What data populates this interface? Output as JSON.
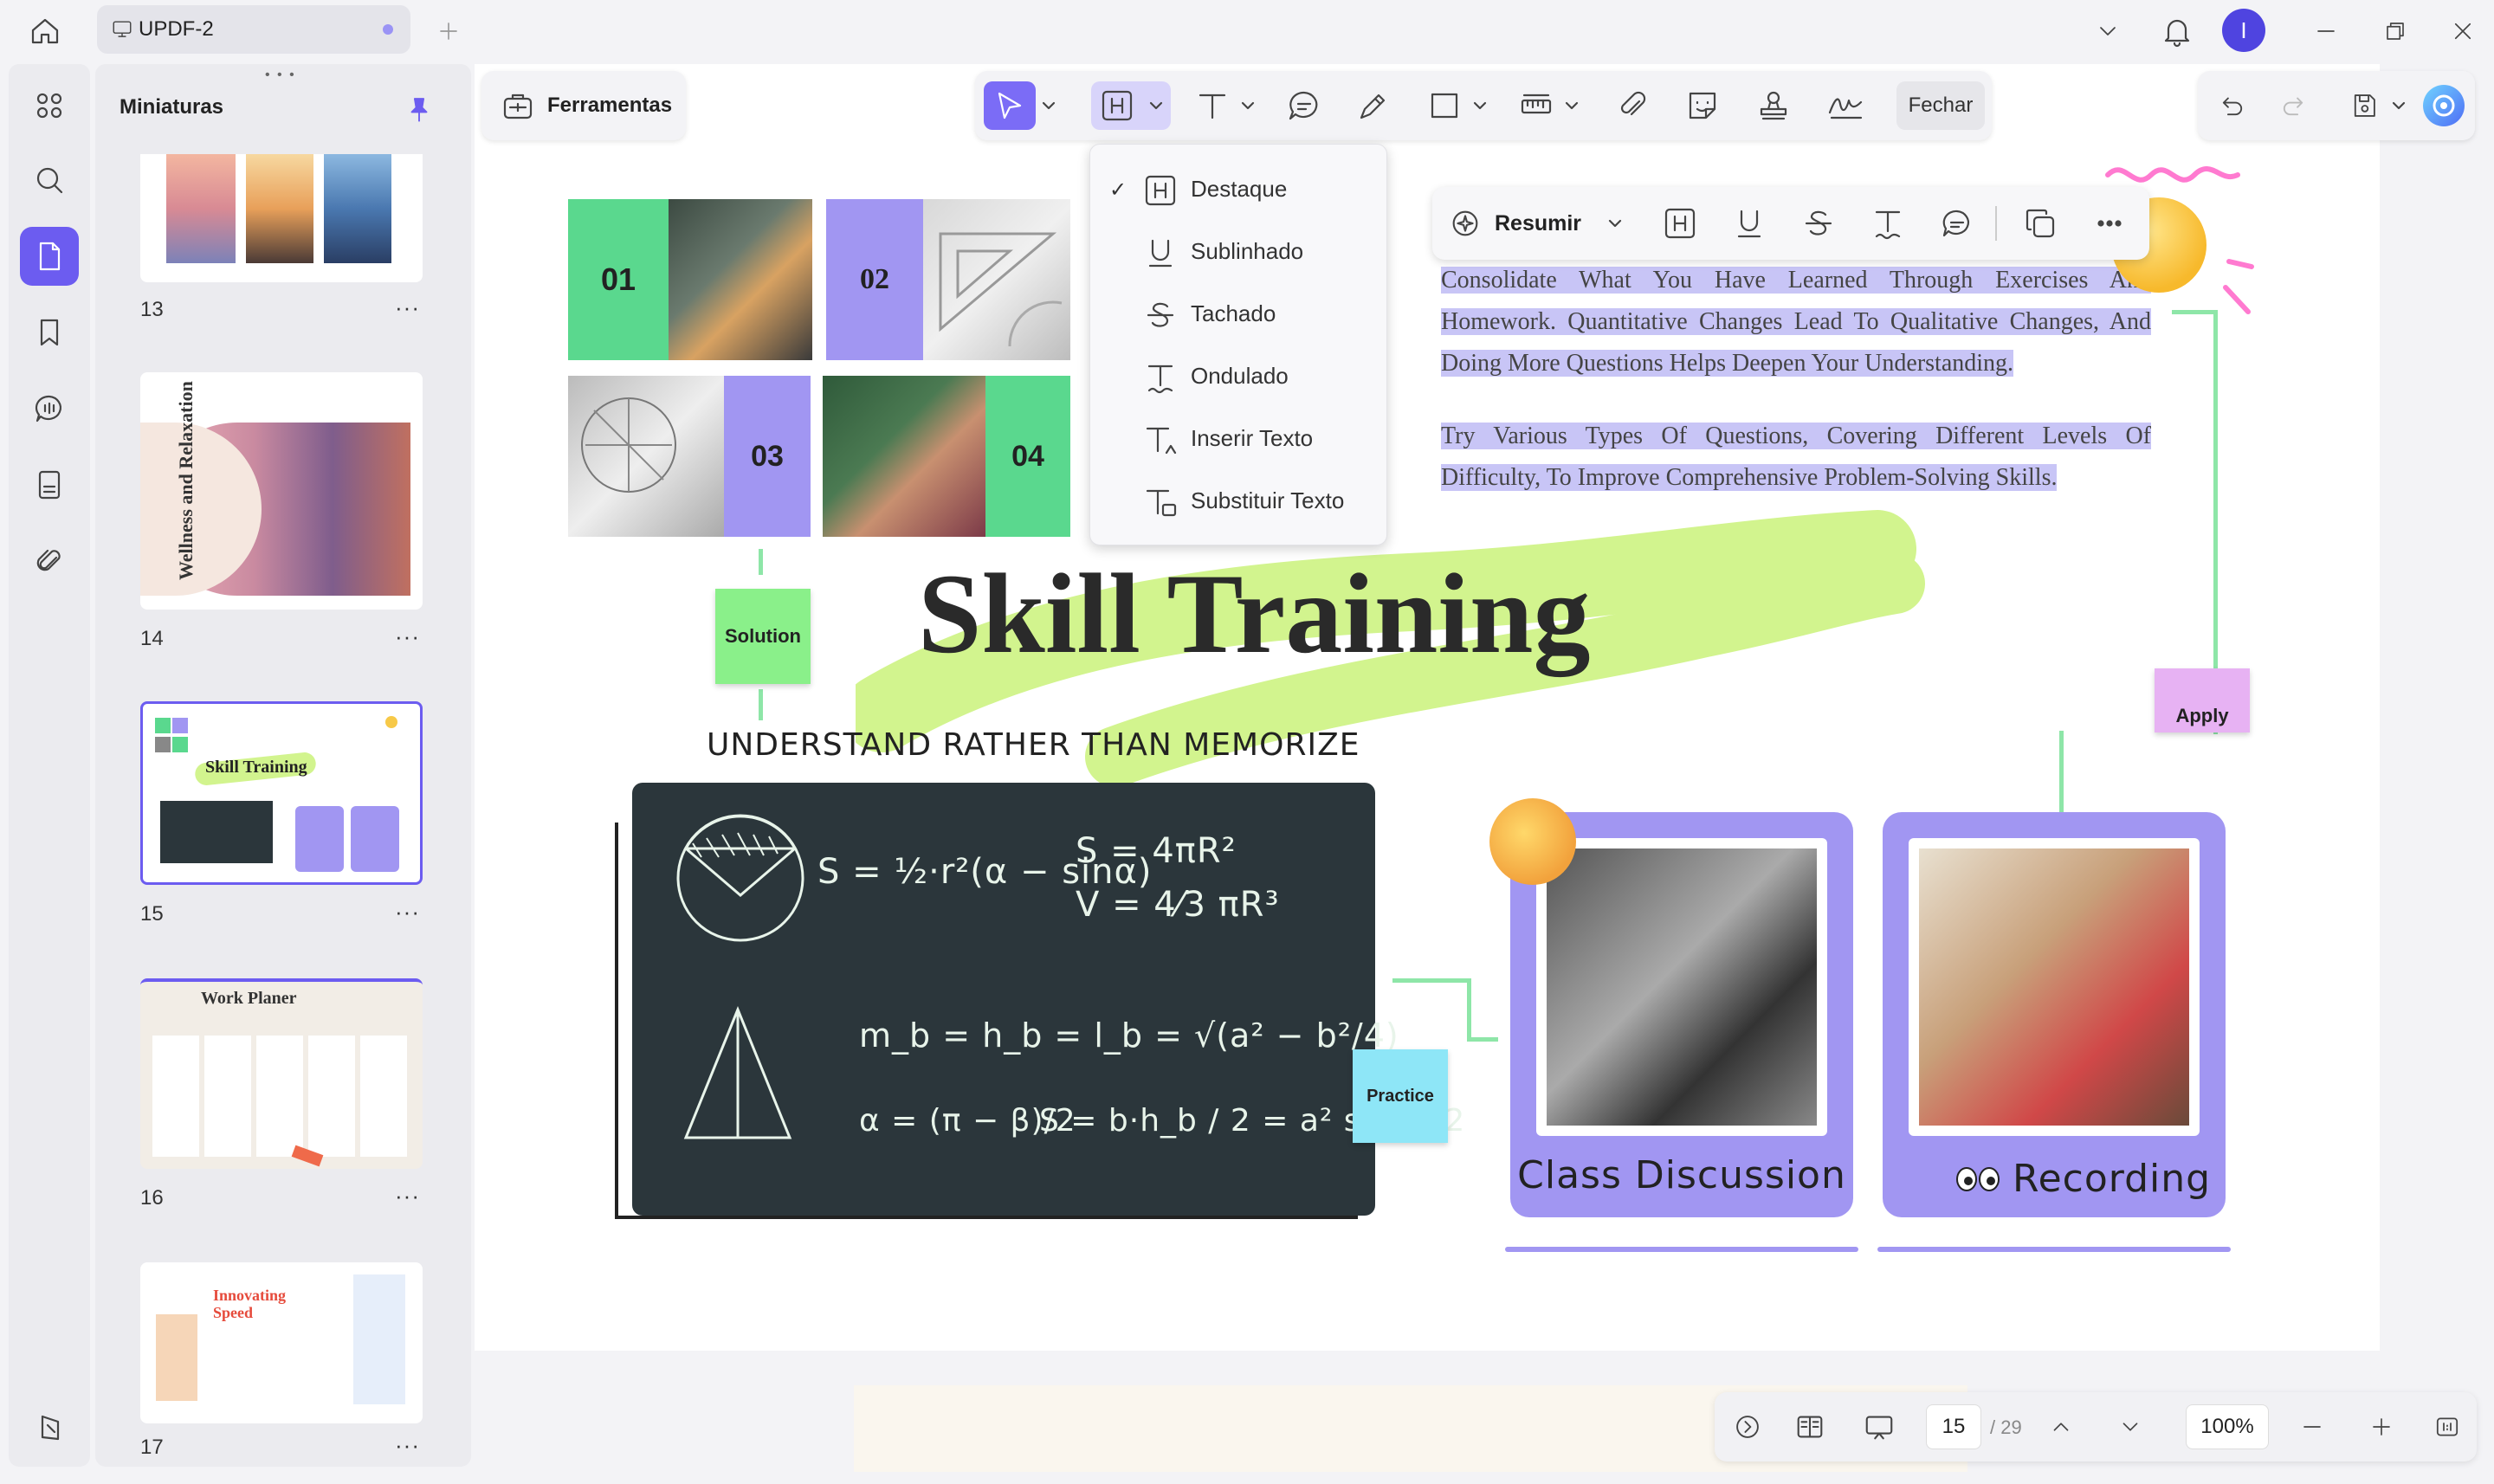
{
  "titlebar": {
    "tab_label": "UPDF-2"
  },
  "sidebar": {
    "panel_title": "Miniaturas",
    "pages": [
      {
        "number": "13",
        "menu": "···"
      },
      {
        "number": "14",
        "menu": "···",
        "thumb_text": "Wellness and Relaxation"
      },
      {
        "number": "15",
        "menu": "···",
        "thumb_text": "Skill Training"
      },
      {
        "number": "16",
        "menu": "···",
        "thumb_text": "Work Planer"
      },
      {
        "number": "17",
        "menu": "···",
        "thumb_text": "Innovating Speed"
      }
    ]
  },
  "toolbar": {
    "tools_label": "Ferramentas",
    "close_label": "Fechar"
  },
  "highlight_menu": {
    "items": [
      {
        "label": "Destaque",
        "checked": true
      },
      {
        "label": "Sublinhado"
      },
      {
        "label": "Tachado"
      },
      {
        "label": "Ondulado"
      },
      {
        "label": "Inserir Texto"
      },
      {
        "label": "Substituir Texto"
      }
    ]
  },
  "selection_toolbar": {
    "summarize_label": "Resumir"
  },
  "document": {
    "title": "Skill Training",
    "subtitle": "UNDERSTAND RATHER THAN MEMORIZE",
    "tiles": [
      "01",
      "02",
      "03",
      "04"
    ],
    "paragraph1": "Consolidate What You Have Learned Through Exercises And Homework. Quantitative Changes Lead To Qualitative Changes, And Doing More Questions Helps Deepen Your Understanding.",
    "paragraph2": "Try Various Types Of Questions, Covering Different Levels Of Difficulty, To Improve Comprehensive Problem-Solving Skills.",
    "solution_note": "Solution",
    "apply_note": "Apply",
    "practice_note": "Practice",
    "card1_label": "Class Discussion",
    "card2_label": "Recording",
    "formulas": {
      "f1": "S = ½·r²(α − sinα)",
      "f2": "S = 4πR²",
      "f3": "V = 4⁄3 πR³",
      "f4": "m_b = h_b = l_b = √(a² − b²/4)",
      "f5": "α = (π − β)/2",
      "f6": "S = b·h_b / 2 = a² sinβ / 2"
    }
  },
  "bottombar": {
    "page_current": "15",
    "page_total": "/ 29",
    "zoom": "100%"
  },
  "colors": {
    "accent": "#7b6cf6",
    "green_tile": "#5ad88e",
    "purple_tile": "#a196f2",
    "lime_brush": "#d2f48e",
    "chalkboard": "#2b363b",
    "cyan_note": "#8ee6f7"
  }
}
